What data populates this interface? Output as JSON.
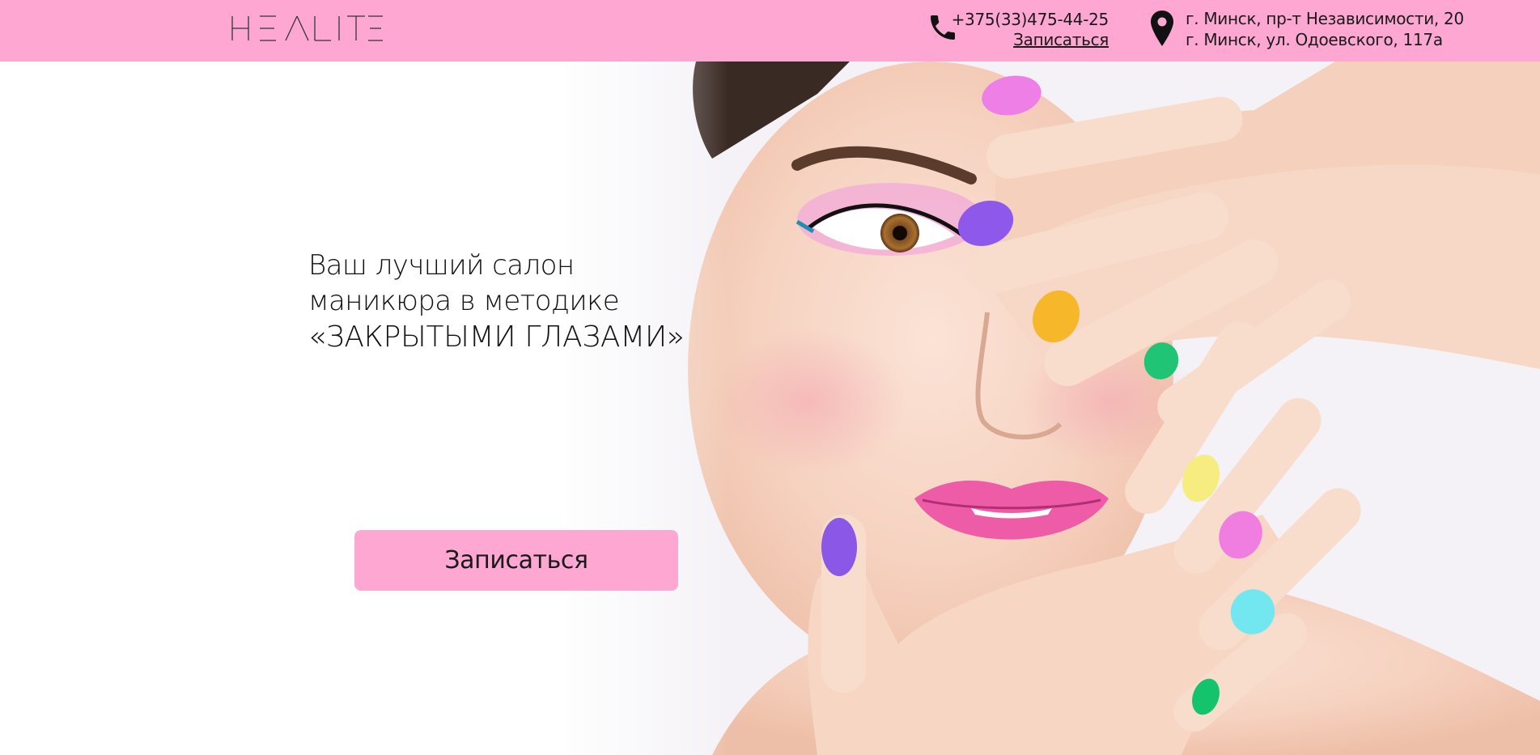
{
  "brand": {
    "logo_text": "HEALITE",
    "header_color": "#ffa7d3"
  },
  "header": {
    "phone": "+375(33)475-44-25",
    "book_link": "Записаться",
    "addresses": [
      "г. Минск, пр-т Независимости, 20",
      "г. Минск, ул. Одоевского, 117а"
    ],
    "icons": {
      "phone": "phone-icon",
      "location": "map-pin-icon"
    }
  },
  "hero": {
    "line1": "Ваш лучший салон",
    "line2": "маникюра в методике",
    "line3": "«ЗАКРЫТЫМИ ГЛАЗАМИ»",
    "cta_label": "Записаться",
    "image": "woman-with-colorful-nails-photo"
  }
}
